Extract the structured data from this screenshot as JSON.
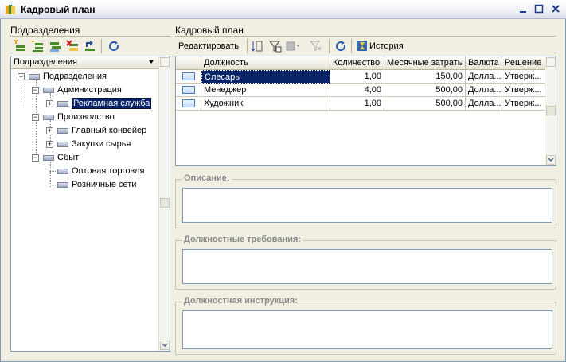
{
  "window": {
    "title": "Кадровый план"
  },
  "left": {
    "section_title": "Подразделения",
    "tree_header": "Подразделения",
    "tree": [
      {
        "label": "Подразделения",
        "level": 0,
        "expander": "minus"
      },
      {
        "label": "Администрация",
        "level": 1,
        "expander": "minus"
      },
      {
        "label": "Рекламная служба",
        "level": 2,
        "expander": "plus",
        "selected": true
      },
      {
        "label": "Производство",
        "level": 1,
        "expander": "minus"
      },
      {
        "label": "Главный конвейер",
        "level": 2,
        "expander": "plus"
      },
      {
        "label": "Закупки сырья",
        "level": 2,
        "expander": "plus"
      },
      {
        "label": "Сбыт",
        "level": 1,
        "expander": "minus"
      },
      {
        "label": "Оптовая торговля",
        "level": 2,
        "expander": "none"
      },
      {
        "label": "Розничные сети",
        "level": 2,
        "expander": "none"
      }
    ]
  },
  "right": {
    "section_title": "Кадровый план",
    "toolbar": {
      "edit_label": "Редактировать",
      "history_label": "История"
    },
    "grid": {
      "columns": [
        "",
        "Должность",
        "Количество",
        "Месячные затраты",
        "Валюта",
        "Решение"
      ],
      "rows": [
        {
          "position": "Слесарь",
          "count": "1,00",
          "cost": "150,00",
          "currency": "Долла...",
          "decision": "Утверж..."
        },
        {
          "position": "Менеджер",
          "count": "4,00",
          "cost": "500,00",
          "currency": "Долла...",
          "decision": "Утверж..."
        },
        {
          "position": "Художник",
          "count": "1,00",
          "cost": "500,00",
          "currency": "Долла...",
          "decision": "Утверж..."
        }
      ]
    },
    "groups": {
      "description": "Описание:",
      "requirements": "Должностные требования:",
      "instruction": "Должностная инструкция:"
    }
  },
  "colors": {
    "selection": "#0a246a",
    "window_bg": "#f1efe2",
    "border": "#7f9db9"
  }
}
